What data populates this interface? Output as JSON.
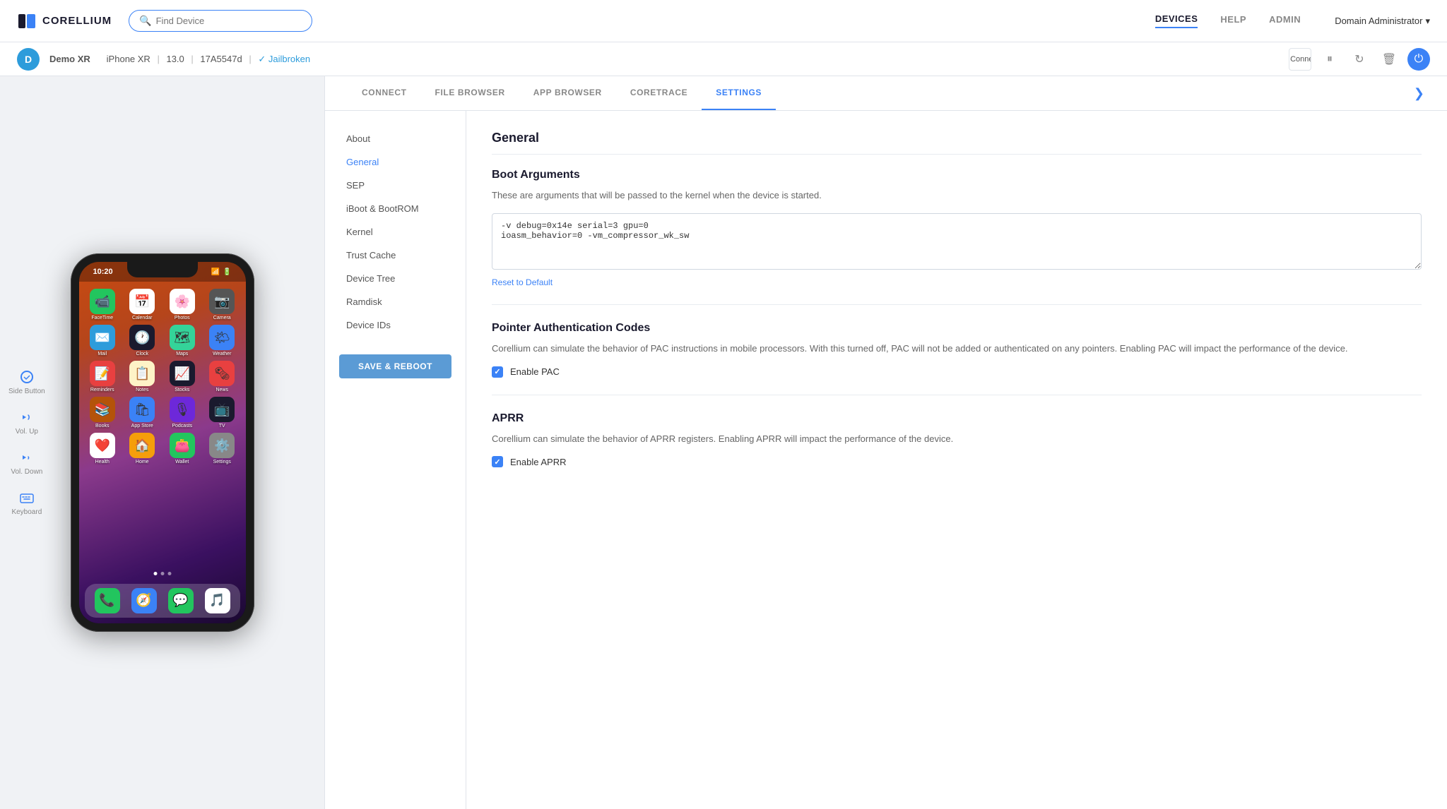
{
  "app": {
    "logo_text": "CORELLIUM"
  },
  "top_nav": {
    "search_placeholder": "Find Device",
    "links": [
      {
        "id": "devices",
        "label": "DEVICES",
        "active": true
      },
      {
        "id": "help",
        "label": "HELP",
        "active": false
      },
      {
        "id": "admin",
        "label": "ADMIN",
        "active": false
      }
    ],
    "user": "Domain Administrator"
  },
  "device_bar": {
    "letter": "D",
    "name": "Demo XR",
    "model": "iPhone XR",
    "ios": "13.0",
    "build": "17A5547d",
    "jailbroken": "✓ Jailbroken"
  },
  "tabs": [
    {
      "id": "connect",
      "label": "CONNECT",
      "active": false
    },
    {
      "id": "file_browser",
      "label": "FILE BROWSER",
      "active": false
    },
    {
      "id": "app_browser",
      "label": "APP BROWSER",
      "active": false
    },
    {
      "id": "coretrace",
      "label": "CORETRACE",
      "active": false
    },
    {
      "id": "settings",
      "label": "SETTINGS",
      "active": true
    }
  ],
  "phone": {
    "time": "10:20",
    "apps": [
      {
        "emoji": "📹",
        "bg": "#22c55e",
        "label": "FaceTime"
      },
      {
        "emoji": "📅",
        "bg": "#e84040",
        "label": "Calendar"
      },
      {
        "emoji": "🌸",
        "bg": "#fff",
        "label": "Photos"
      },
      {
        "emoji": "📷",
        "bg": "#888",
        "label": "Camera"
      },
      {
        "emoji": "✉️",
        "bg": "#2d9cdb",
        "label": "Mail"
      },
      {
        "emoji": "🕐",
        "bg": "#fff",
        "label": "Clock"
      },
      {
        "emoji": "🗺",
        "bg": "#34d399",
        "label": "Maps"
      },
      {
        "emoji": "🌤",
        "bg": "#3b82f6",
        "label": "Weather"
      },
      {
        "emoji": "📝",
        "bg": "#f59e0b",
        "label": "Reminders"
      },
      {
        "emoji": "📋",
        "bg": "#fef3c7",
        "label": "Notes"
      },
      {
        "emoji": "📈",
        "bg": "#1a1a2e",
        "label": "Stocks"
      },
      {
        "emoji": "🗞",
        "bg": "#e84040",
        "label": "News"
      },
      {
        "emoji": "📚",
        "bg": "#b45309",
        "label": "Books"
      },
      {
        "emoji": "🛍",
        "bg": "#3b82f6",
        "label": "App Store"
      },
      {
        "emoji": "🎙",
        "bg": "#6d28d9",
        "label": "Podcasts"
      },
      {
        "emoji": "📺",
        "bg": "#1a1a2e",
        "label": "TV"
      },
      {
        "emoji": "❤️",
        "bg": "#fff",
        "label": "Health"
      },
      {
        "emoji": "🏠",
        "bg": "#f59e0b",
        "label": "Home"
      },
      {
        "emoji": "👛",
        "bg": "#22c55e",
        "label": "Wallet"
      },
      {
        "emoji": "⚙️",
        "bg": "#888",
        "label": "Settings"
      }
    ],
    "dock": [
      {
        "emoji": "📞",
        "bg": "#22c55e"
      },
      {
        "emoji": "🧭",
        "bg": "#3b82f6"
      },
      {
        "emoji": "💬",
        "bg": "#22c55e"
      },
      {
        "emoji": "🎵",
        "bg": "#fff"
      }
    ]
  },
  "side_controls": [
    {
      "id": "side-button",
      "label": "Side Button"
    },
    {
      "id": "vol-up",
      "label": "Vol. Up"
    },
    {
      "id": "vol-down",
      "label": "Vol. Down"
    },
    {
      "id": "keyboard",
      "label": "Keyboard"
    }
  ],
  "settings_menu": {
    "items": [
      {
        "id": "about",
        "label": "About",
        "active": false
      },
      {
        "id": "general",
        "label": "General",
        "active": true
      },
      {
        "id": "sep",
        "label": "SEP",
        "active": false
      },
      {
        "id": "iboot",
        "label": "iBoot & BootROM",
        "active": false
      },
      {
        "id": "kernel",
        "label": "Kernel",
        "active": false
      },
      {
        "id": "trust-cache",
        "label": "Trust Cache",
        "active": false
      },
      {
        "id": "device-tree",
        "label": "Device Tree",
        "active": false
      },
      {
        "id": "ramdisk",
        "label": "Ramdisk",
        "active": false
      },
      {
        "id": "device-ids",
        "label": "Device IDs",
        "active": false
      }
    ],
    "save_reboot_label": "SAVE & REBOOT"
  },
  "settings_content": {
    "section_title": "General",
    "boot_arguments": {
      "title": "Boot Arguments",
      "description": "These are arguments that will be passed to the kernel when the device is started.",
      "value": "-v debug=0x14e serial=3 gpu=0\nioasm_behavior=0 -vm_compressor_wk_sw",
      "reset_label": "Reset to Default"
    },
    "pac": {
      "title": "Pointer Authentication Codes",
      "description": "Corellium can simulate the behavior of PAC instructions in mobile processors. With this turned off, PAC will not be added or authenticated on any pointers. Enabling PAC will impact the performance of the device.",
      "checkbox_label": "Enable PAC",
      "checked": true
    },
    "aprr": {
      "title": "APRR",
      "description": "Corellium can simulate the behavior of APRR registers. Enabling APRR will impact the performance of the device.",
      "checkbox_label": "Enable APRR",
      "checked": true
    }
  }
}
